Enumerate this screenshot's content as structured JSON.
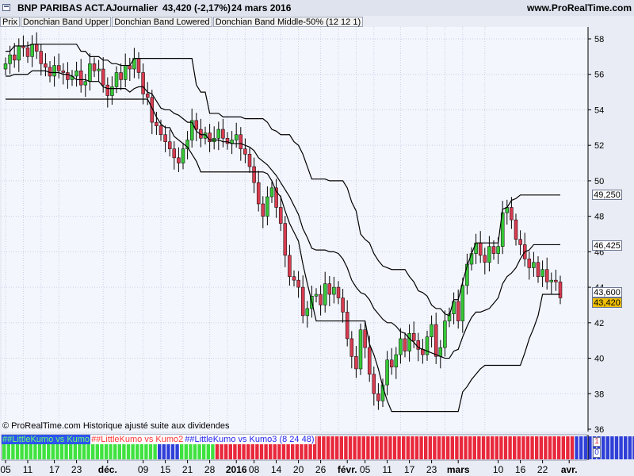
{
  "window": {
    "instrument": "BNP PARIBAS ACT.A",
    "period": "Journalier",
    "last_quote": "43,420 (-2,17%)",
    "date": "24 mars 2016",
    "site": "www.ProRealTime.com"
  },
  "legend": {
    "items": [
      "Prix",
      "Donchian Band Upper",
      "Donchian Band Lowered",
      "Donchian Band Middle-50% (12 12 1)"
    ]
  },
  "credit": "© ProRealTime.com Historique ajusté suite aux dividendes",
  "price_tags": {
    "upper": "49,250",
    "middle": "46,425",
    "lower": "43,600",
    "last": "43,420"
  },
  "oscillator": {
    "labels": [
      "##LittleKumo vs Kumo",
      "##LittleKumo vs Kumo2",
      "##LittleKumo vs Kumo3 (8 24 48)"
    ],
    "label_colors": [
      "#6cff6c",
      "#ff3333",
      "#2222ee"
    ],
    "label_backgrounds": [
      "#2e54ee",
      "#ffffff",
      "#ffffff"
    ],
    "scale": [
      "1",
      "0"
    ],
    "colors": {
      "green": "#3fe23f",
      "red": "#e8283c",
      "blue": "#2f3fd8"
    },
    "segments": [
      {
        "color": "green",
        "days": 35
      },
      {
        "color": "blue",
        "days": 5
      },
      {
        "color": "green",
        "days": 8
      },
      {
        "color": "red",
        "days": 81
      },
      {
        "color": "blue",
        "days": 18
      }
    ]
  },
  "colors": {
    "bull": "#37c837",
    "bear": "#d83c50",
    "band": "#000000",
    "last_tag": "#f0c000"
  },
  "chart_data": {
    "type": "candlestick",
    "title": "BNP PARIBAS ACT.A",
    "ylim": [
      36,
      59
    ],
    "y_ticks": [
      36,
      38,
      40,
      42,
      44,
      46,
      48,
      50,
      52,
      54,
      56,
      58
    ],
    "x_tick_labels": [
      "05",
      "11",
      "17",
      "23",
      "déc.",
      "09",
      "15",
      "21",
      "28",
      "2016",
      "08",
      "14",
      "20",
      "26",
      "févr.",
      "05",
      "11",
      "17",
      "23",
      "mars",
      "10",
      "16",
      "22",
      "avr."
    ],
    "grid": true,
    "close": [
      56.6,
      57.1,
      56.8,
      57.6,
      57.5,
      57.0,
      57.7,
      57.3,
      56.6,
      56.4,
      55.9,
      56.5,
      56.2,
      56.1,
      55.7,
      55.9,
      56.2,
      55.4,
      55.6,
      56.6,
      56.2,
      56.3,
      55.4,
      54.8,
      55.3,
      56.1,
      55.7,
      56.5,
      56.3,
      56.9,
      56.1,
      54.9,
      54.7,
      53.3,
      53.1,
      52.6,
      52.2,
      51.8,
      51.3,
      51.0,
      51.8,
      52.3,
      53.4,
      52.9,
      52.4,
      52.7,
      52.2,
      52.4,
      52.9,
      52.4,
      52.1,
      52.3,
      52.6,
      51.8,
      51.5,
      50.8,
      49.9,
      48.7,
      48.0,
      49.1,
      49.6,
      48.5,
      47.6,
      45.8,
      44.6,
      44.4,
      44.0,
      42.4,
      42.8,
      43.5,
      43.6,
      43.0,
      44.2,
      43.6,
      44.0,
      43.4,
      42.6,
      41.1,
      40.1,
      39.4,
      41.6,
      40.6,
      39.1,
      38.0,
      37.6,
      38.5,
      39.9,
      39.5,
      40.2,
      41.1,
      40.4,
      41.4,
      41.0,
      40.5,
      40.2,
      41.2,
      41.9,
      40.1,
      40.6,
      42.1,
      42.5,
      43.2,
      42.1,
      44.1,
      45.3,
      45.9,
      46.5,
      45.8,
      45.4,
      46.3,
      45.9,
      46.3,
      48.2,
      48.5,
      47.8,
      46.7,
      46.4,
      45.6,
      45.1,
      45.4,
      44.6,
      45.0,
      44.3,
      44.4,
      44.3,
      43.4
    ],
    "series": [
      {
        "name": "Donchian Band Upper",
        "values": [
          57.3,
          57.3,
          57.6,
          57.6,
          57.6,
          57.6,
          57.7,
          57.7,
          57.7,
          57.7,
          57.7,
          57.7,
          57.7,
          57.7,
          57.7,
          57.7,
          57.7,
          57.3,
          57.3,
          57.0,
          57.0,
          57.0,
          56.8,
          56.8,
          56.6,
          56.6,
          56.5,
          56.5,
          56.5,
          56.9,
          56.9,
          56.9,
          56.9,
          56.9,
          56.9,
          56.9,
          56.9,
          56.9,
          56.9,
          56.9,
          56.9,
          56.9,
          56.9,
          55.4,
          55.0,
          55.0,
          53.8,
          53.8,
          53.8,
          53.6,
          53.6,
          53.6,
          53.6,
          53.6,
          53.5,
          53.5,
          53.5,
          53.5,
          53.5,
          53.3,
          52.9,
          52.8,
          52.6,
          52.6,
          52.6,
          52.2,
          52.0,
          51.5,
          50.8,
          50.1,
          50.1,
          50.1,
          50.1,
          50.0,
          50.0,
          50.0,
          50.0,
          49.6,
          48.8,
          48.3,
          47.0,
          46.7,
          46.5,
          45.9,
          45.5,
          45.2,
          45.1,
          45.0,
          45.0,
          45.0,
          45.0,
          44.6,
          44.3,
          43.8,
          43.7,
          43.5,
          43.0,
          42.8,
          42.8,
          42.5,
          42.4,
          43.3,
          43.3,
          44.3,
          45.2,
          45.9,
          46.5,
          46.5,
          46.5,
          46.5,
          46.5,
          46.5,
          48.4,
          48.5,
          48.9,
          49.0,
          49.2,
          49.2,
          49.2,
          49.2,
          49.2,
          49.2,
          49.2,
          49.2,
          49.2,
          49.2
        ],
        "color": "#000000"
      },
      {
        "name": "Donchian Band Middle-50%",
        "values": [
          55.9,
          55.9,
          56.0,
          56.0,
          56.0,
          56.0,
          56.2,
          56.2,
          56.2,
          56.2,
          56.1,
          56.1,
          56.1,
          56.0,
          56.0,
          55.9,
          55.7,
          55.7,
          55.7,
          55.6,
          55.6,
          55.6,
          55.3,
          55.2,
          55.2,
          55.2,
          55.2,
          55.2,
          55.0,
          55.2,
          55.3,
          55.3,
          55.0,
          54.9,
          54.5,
          54.1,
          54.0,
          54.0,
          53.8,
          53.7,
          53.5,
          53.3,
          53.3,
          52.8,
          52.6,
          52.6,
          52.3,
          52.3,
          52.3,
          52.2,
          52.2,
          52.1,
          52.1,
          52.1,
          52.0,
          51.9,
          51.7,
          51.3,
          51.1,
          50.9,
          50.6,
          50.3,
          49.9,
          49.5,
          49.1,
          48.6,
          48.1,
          47.3,
          46.8,
          46.2,
          46.1,
          46.1,
          46.1,
          46.0,
          46.0,
          45.9,
          45.6,
          45.1,
          44.4,
          44.0,
          43.7,
          43.6,
          43.3,
          42.8,
          42.5,
          42.2,
          42.0,
          42.0,
          41.8,
          41.5,
          41.4,
          41.1,
          40.9,
          40.6,
          40.5,
          40.4,
          40.3,
          40.2,
          40.1,
          40.0,
          40.0,
          40.4,
          40.5,
          41.2,
          41.8,
          42.3,
          42.6,
          42.6,
          42.7,
          42.8,
          43.1,
          43.4,
          44.2,
          44.6,
          44.8,
          45.1,
          45.6,
          46.0,
          46.1,
          46.4,
          46.4,
          46.4,
          46.4,
          46.4,
          46.4,
          46.4
        ],
        "color": "#000000"
      },
      {
        "name": "Donchian Band Lowered",
        "values": [
          54.6,
          54.6,
          54.6,
          54.6,
          54.6,
          54.6,
          54.6,
          54.6,
          54.6,
          54.6,
          54.6,
          54.6,
          54.6,
          54.6,
          54.6,
          54.6,
          54.6,
          54.6,
          54.6,
          54.6,
          54.6,
          54.6,
          54.6,
          54.6,
          54.6,
          54.6,
          54.6,
          54.6,
          54.6,
          54.6,
          54.6,
          54.6,
          54.6,
          54.1,
          53.6,
          53.2,
          53.0,
          53.0,
          52.5,
          52.3,
          52.1,
          51.9,
          51.5,
          51.1,
          50.5,
          50.5,
          50.5,
          50.5,
          50.5,
          50.5,
          50.5,
          50.5,
          50.5,
          50.5,
          50.5,
          50.5,
          50.5,
          50.5,
          50.5,
          50.4,
          50.0,
          49.4,
          49.1,
          48.3,
          47.6,
          47.1,
          46.6,
          45.3,
          44.2,
          43.2,
          42.1,
          42.1,
          42.1,
          42.1,
          42.1,
          42.1,
          42.1,
          42.1,
          42.1,
          42.1,
          42.1,
          42.1,
          40.8,
          40.2,
          39.4,
          38.4,
          37.6,
          37.0,
          37.0,
          37.0,
          37.0,
          37.0,
          37.0,
          37.0,
          37.0,
          37.0,
          37.0,
          37.0,
          37.0,
          37.0,
          37.0,
          37.0,
          37.0,
          38.1,
          38.4,
          38.8,
          39.1,
          39.4,
          39.6,
          39.6,
          39.6,
          39.6,
          39.6,
          39.6,
          39.6,
          39.6,
          39.6,
          40.3,
          41.1,
          41.7,
          42.4,
          43.6,
          43.6,
          43.6,
          43.6,
          43.6
        ],
        "color": "#000000"
      }
    ]
  }
}
